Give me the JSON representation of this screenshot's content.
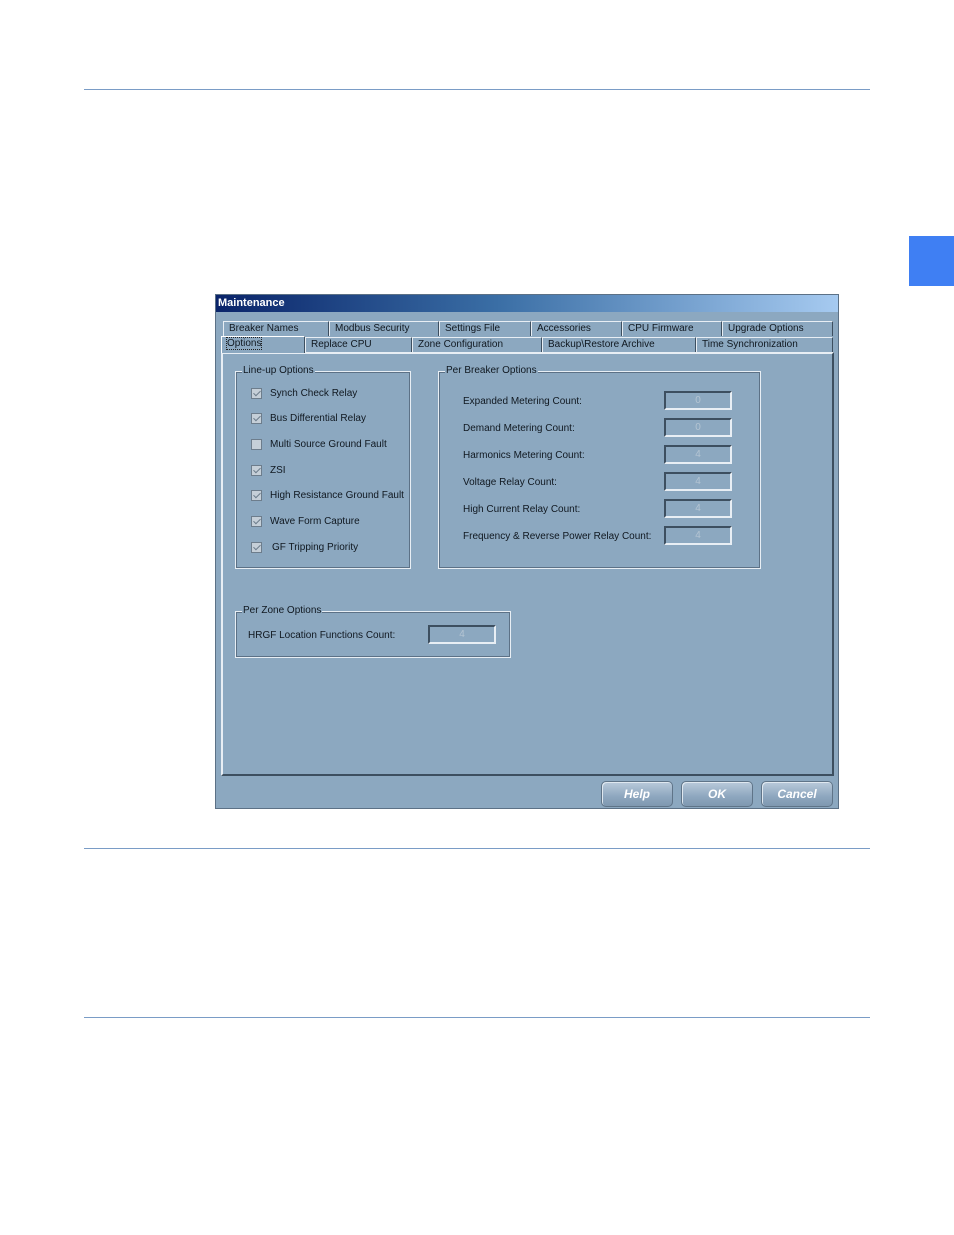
{
  "dialog": {
    "title": "Maintenance",
    "tabs_back": [
      {
        "label": "Breaker Names"
      },
      {
        "label": "Modbus Security"
      },
      {
        "label": "Settings File"
      },
      {
        "label": "Accessories"
      },
      {
        "label": "CPU Firmware"
      },
      {
        "label": "Upgrade Options"
      }
    ],
    "tabs_front": [
      {
        "label": "Options"
      },
      {
        "label": "Replace CPU"
      },
      {
        "label": "Zone Configuration"
      },
      {
        "label": "Backup\\Restore Archive"
      },
      {
        "label": "Time Synchronization"
      }
    ],
    "lineup": {
      "title": "Line-up Options",
      "items": [
        {
          "label": "Synch Check Relay",
          "checked": true
        },
        {
          "label": "Bus Differential Relay",
          "checked": true
        },
        {
          "label": "Multi Source Ground Fault",
          "checked": false
        },
        {
          "label": "ZSI",
          "checked": true
        },
        {
          "label": "High Resistance Ground Fault",
          "checked": true
        },
        {
          "label": "Wave Form Capture",
          "checked": true
        },
        {
          "label": "GF Tripping Priority",
          "checked": true
        }
      ]
    },
    "per_breaker": {
      "title": "Per Breaker Options",
      "fields": [
        {
          "label": "Expanded Metering Count:",
          "value": "0"
        },
        {
          "label": "Demand Metering Count:",
          "value": "0"
        },
        {
          "label": "Harmonics Metering Count:",
          "value": "4"
        },
        {
          "label": "Voltage Relay Count:",
          "value": "4"
        },
        {
          "label": "High Current Relay Count:",
          "value": "4"
        },
        {
          "label": "Frequency & Reverse Power Relay Count:",
          "value": "4"
        }
      ]
    },
    "per_zone": {
      "title": "Per Zone Options",
      "field": {
        "label": "HRGF Location Functions Count:",
        "value": "4"
      }
    },
    "buttons": {
      "help": "Help",
      "ok": "OK",
      "cancel": "Cancel"
    }
  }
}
